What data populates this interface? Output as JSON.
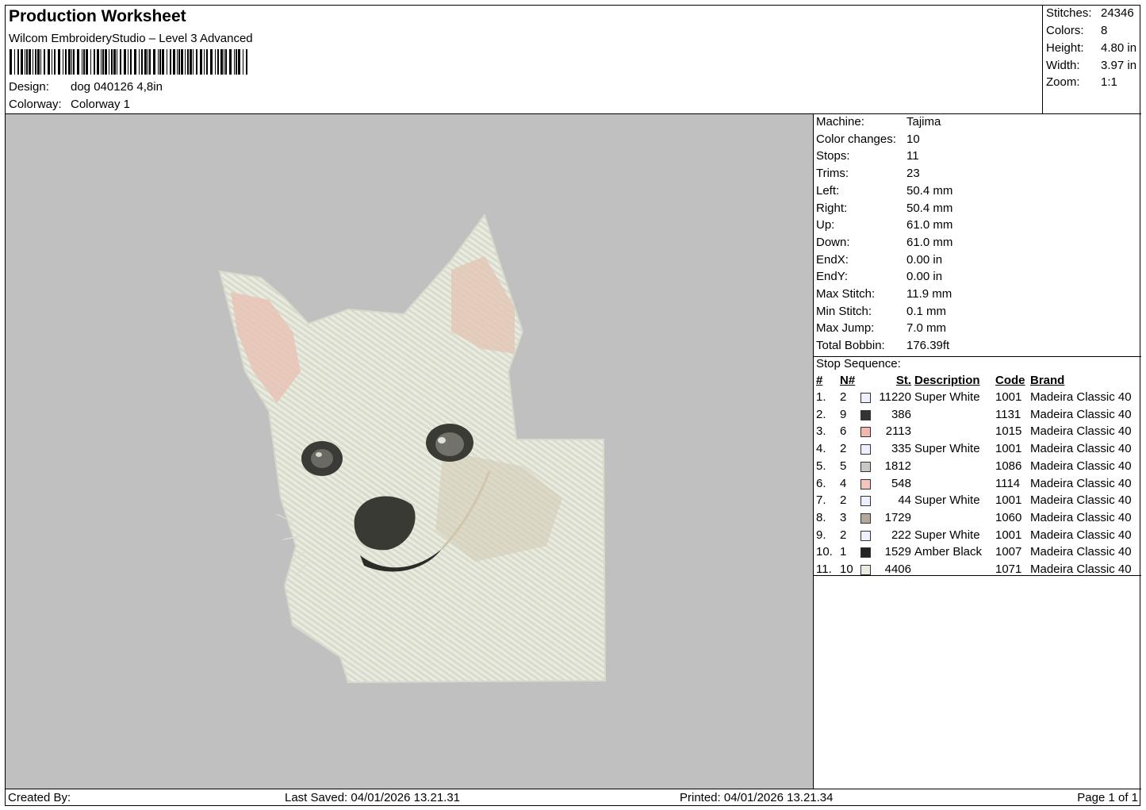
{
  "header": {
    "title": "Production Worksheet",
    "software": "Wilcom EmbroideryStudio – Level 3 Advanced",
    "design_label": "Design:",
    "design_value": "dog 040126 4,8in",
    "colorway_label": "Colorway:",
    "colorway_value": "Colorway 1"
  },
  "stats": {
    "stitches_label": "Stitches:",
    "stitches_value": "24346",
    "colors_label": "Colors:",
    "colors_value": "8",
    "height_label": "Height:",
    "height_value": "4.80 in",
    "width_label": "Width:",
    "width_value": "3.97 in",
    "zoom_label": "Zoom:",
    "zoom_value": "1:1"
  },
  "machine_info": [
    {
      "label": "Machine:",
      "value": "Tajima"
    },
    {
      "label": "Color changes:",
      "value": "10"
    },
    {
      "label": "Stops:",
      "value": "11"
    },
    {
      "label": "Trims:",
      "value": "23"
    },
    {
      "label": "Left:",
      "value": "50.4 mm"
    },
    {
      "label": "Right:",
      "value": "50.4 mm"
    },
    {
      "label": "Up:",
      "value": "61.0 mm"
    },
    {
      "label": "Down:",
      "value": "61.0 mm"
    },
    {
      "label": "EndX:",
      "value": "0.00 in"
    },
    {
      "label": "EndY:",
      "value": "0.00 in"
    },
    {
      "label": "Max Stitch:",
      "value": "11.9 mm"
    },
    {
      "label": "Min Stitch:",
      "value": "0.1 mm"
    },
    {
      "label": "Max Jump:",
      "value": "7.0 mm"
    },
    {
      "label": "Total Bobbin:",
      "value": "176.39ft"
    }
  ],
  "stop_sequence": {
    "label": "Stop Sequence:",
    "headers": {
      "num": "#",
      "n": "N#",
      "st": "St.",
      "desc": "Description",
      "code": "Code",
      "brand": "Brand"
    },
    "rows": [
      {
        "num": "1.",
        "n": "2",
        "color": "#eef0ff",
        "st": "11220",
        "desc": "Super White",
        "code": "1001",
        "brand": "Madeira Classic 40"
      },
      {
        "num": "2.",
        "n": "9",
        "color": "#333333",
        "st": "386",
        "desc": "",
        "code": "1131",
        "brand": "Madeira Classic 40"
      },
      {
        "num": "3.",
        "n": "6",
        "color": "#f1b7b0",
        "st": "2113",
        "desc": "",
        "code": "1015",
        "brand": "Madeira Classic 40"
      },
      {
        "num": "4.",
        "n": "2",
        "color": "#eef0ff",
        "st": "335",
        "desc": "Super White",
        "code": "1001",
        "brand": "Madeira Classic 40"
      },
      {
        "num": "5.",
        "n": "5",
        "color": "#c8c8c4",
        "st": "1812",
        "desc": "",
        "code": "1086",
        "brand": "Madeira Classic 40"
      },
      {
        "num": "6.",
        "n": "4",
        "color": "#f5c4bd",
        "st": "548",
        "desc": "",
        "code": "1114",
        "brand": "Madeira Classic 40"
      },
      {
        "num": "7.",
        "n": "2",
        "color": "#eef0ff",
        "st": "44",
        "desc": "Super White",
        "code": "1001",
        "brand": "Madeira Classic 40"
      },
      {
        "num": "8.",
        "n": "3",
        "color": "#b3a89a",
        "st": "1729",
        "desc": "",
        "code": "1060",
        "brand": "Madeira Classic 40"
      },
      {
        "num": "9.",
        "n": "2",
        "color": "#eef0ff",
        "st": "222",
        "desc": "Super White",
        "code": "1001",
        "brand": "Madeira Classic 40"
      },
      {
        "num": "10.",
        "n": "1",
        "color": "#222222",
        "st": "1529",
        "desc": "Amber Black",
        "code": "1007",
        "brand": "Madeira Classic 40"
      },
      {
        "num": "11.",
        "n": "10",
        "color": "#ecebe2",
        "st": "4406",
        "desc": "",
        "code": "1071",
        "brand": "Madeira Classic 40"
      }
    ]
  },
  "footer": {
    "created_by": "Created By:",
    "last_saved": "Last Saved: 04/01/2026 13.21.31",
    "printed": "Printed: 04/01/2026 13.21.34",
    "page": "Page 1 of 1"
  },
  "colors": {
    "canvas_bg": "#c0c0c0",
    "fabric": "#e3e6d8"
  }
}
